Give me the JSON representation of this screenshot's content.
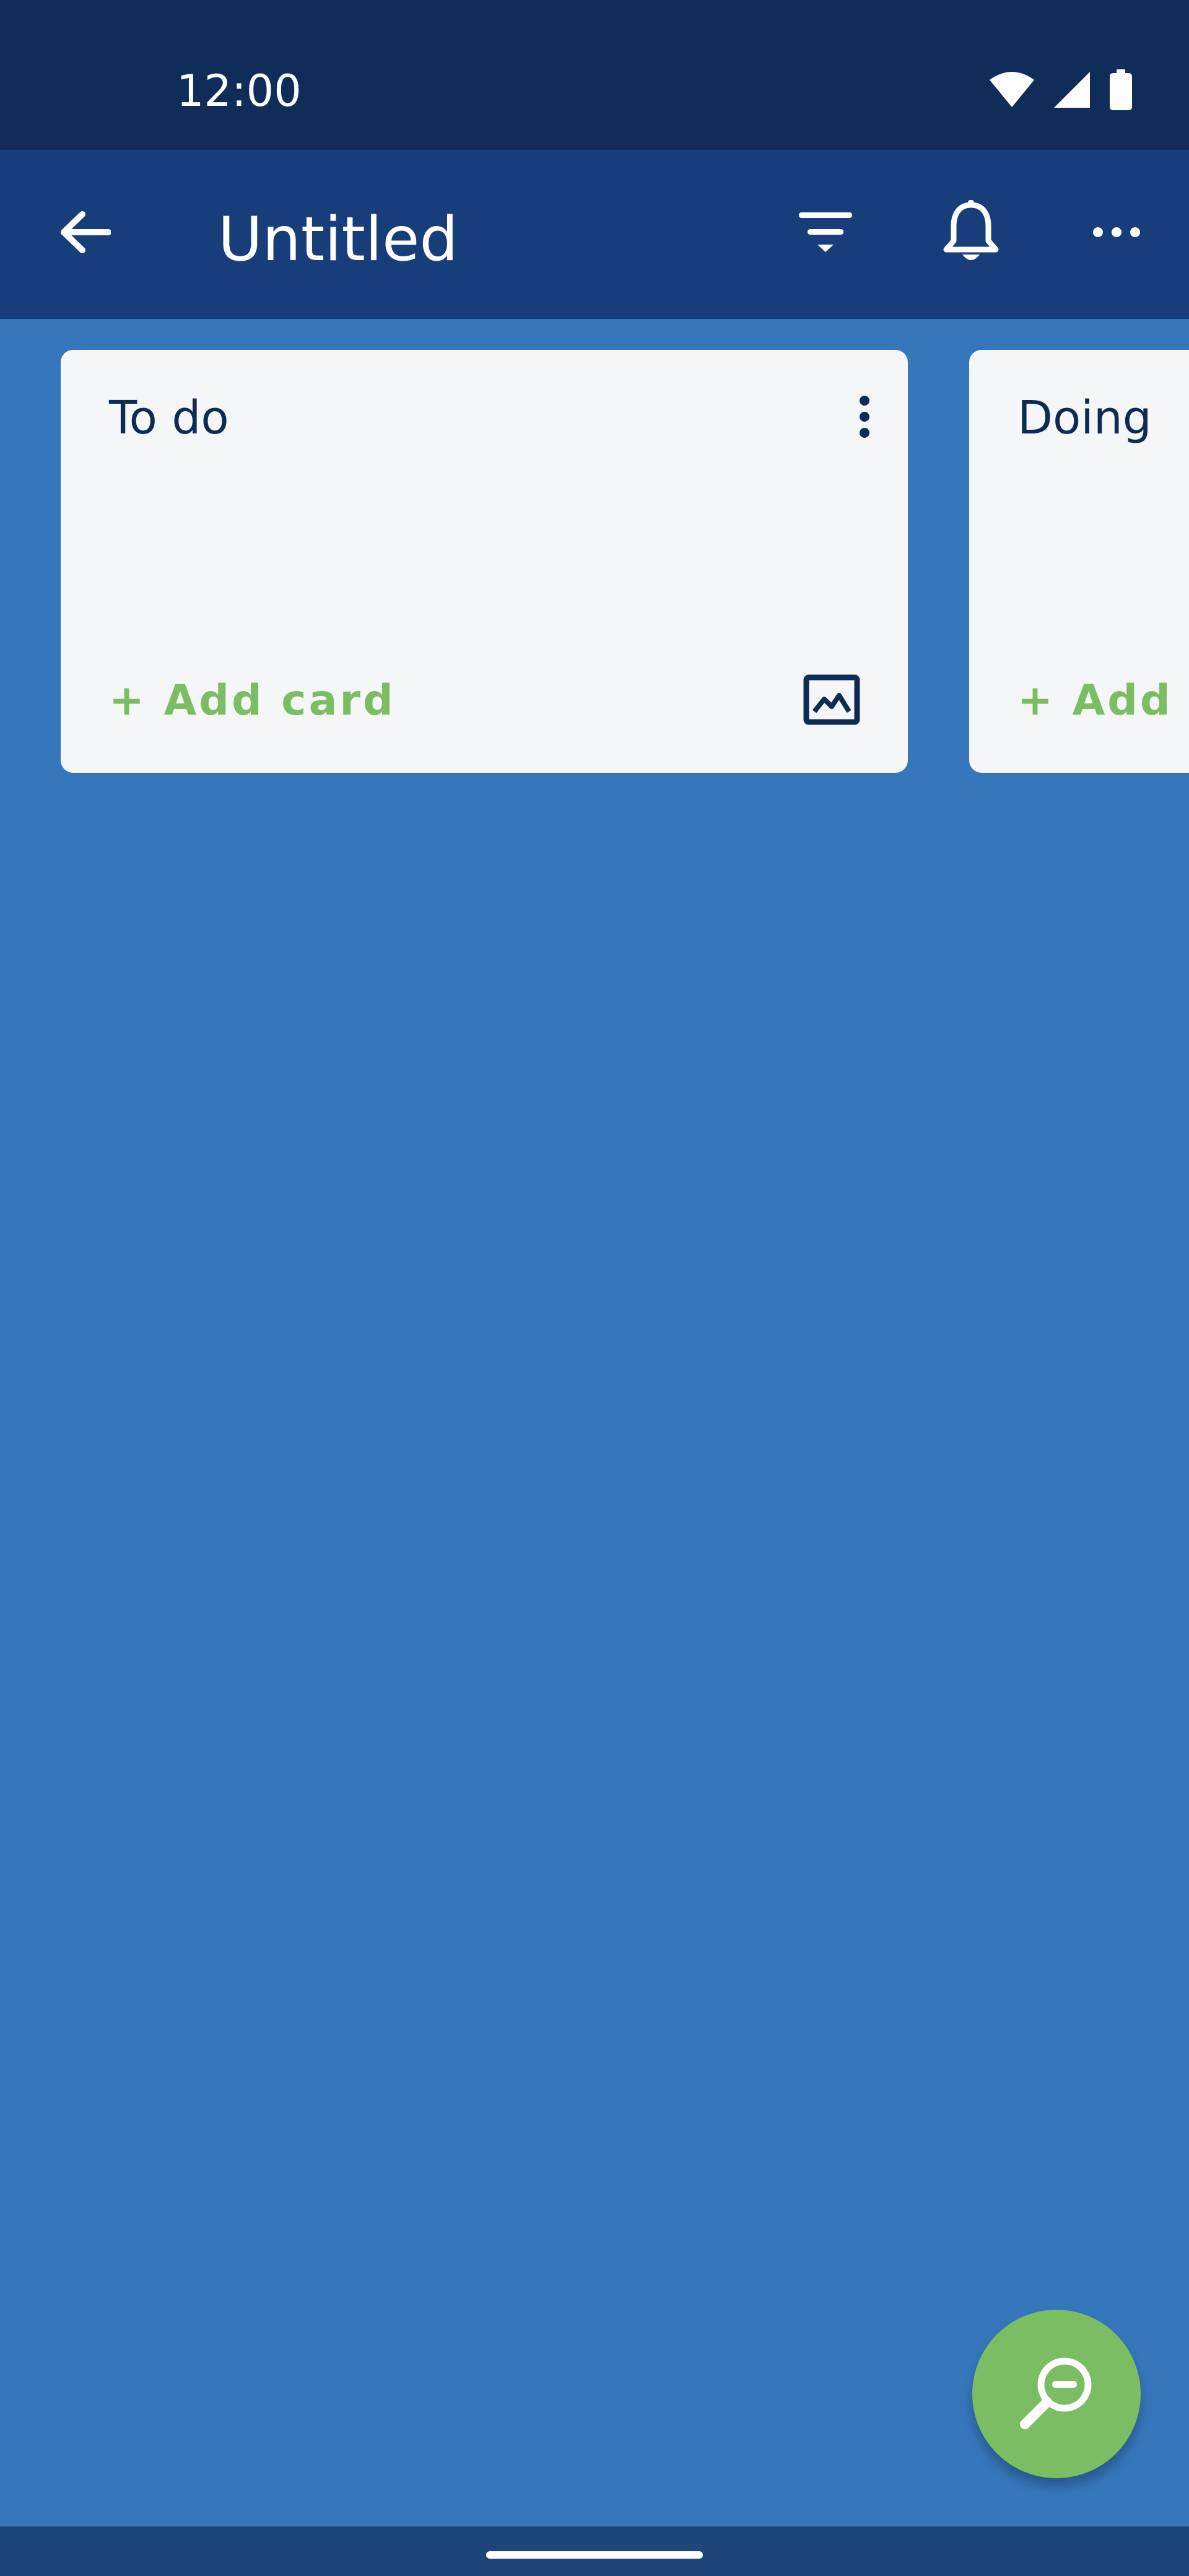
{
  "status_bar": {
    "time": "12:00",
    "icons": [
      "wifi-icon",
      "signal-icon",
      "battery-icon"
    ]
  },
  "app_bar": {
    "title": "Untitled",
    "icons": [
      "back-arrow-icon",
      "filter-icon",
      "bell-icon",
      "more-horizontal-icon"
    ]
  },
  "lists": [
    {
      "title": "To do",
      "add_card_label": "+ Add card"
    },
    {
      "title": "Doing",
      "add_card_label": "+ Add card"
    }
  ],
  "fab": {
    "icon": "zoom-out-icon"
  },
  "colors": {
    "status_bar": "#102c58",
    "app_bar": "#183d7b",
    "board_background": "#3677bc",
    "list_background": "#f4f6f8",
    "accent_green": "#7bbd62",
    "text_dark": "#0e2b55"
  }
}
